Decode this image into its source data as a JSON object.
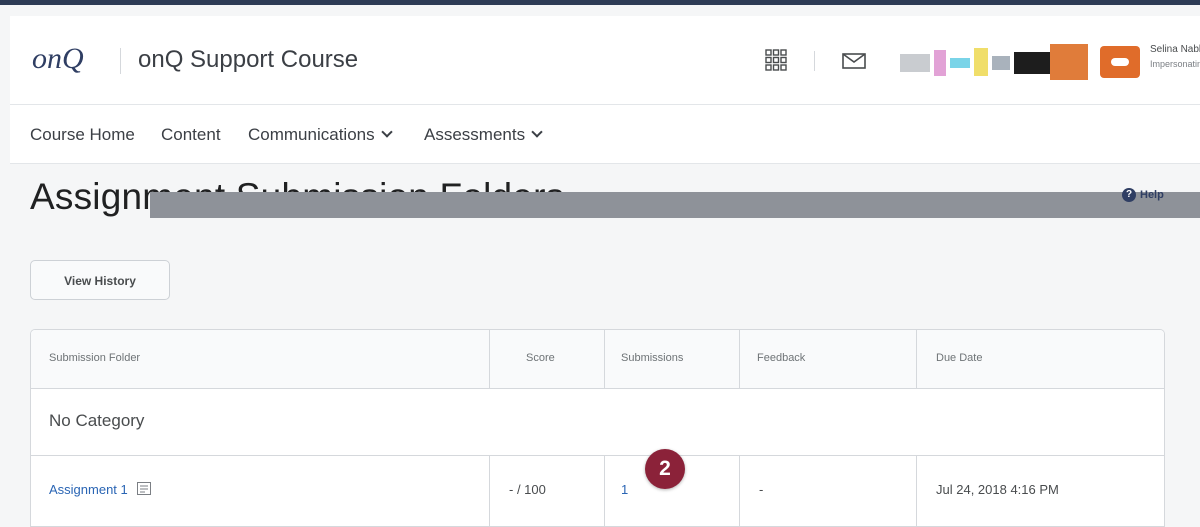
{
  "header": {
    "logo_text": "onQ",
    "course_title": "onQ Support Course",
    "user_name": "Selina Nabbs",
    "user_role": "Impersonating",
    "icons": [
      "apps-grid-icon",
      "message-icon"
    ]
  },
  "nav": {
    "items": [
      {
        "label": "Course Home",
        "dropdown": false
      },
      {
        "label": "Content",
        "dropdown": false
      },
      {
        "label": "Communications",
        "dropdown": true
      },
      {
        "label": "Assessments",
        "dropdown": true
      }
    ]
  },
  "page": {
    "title": "Assignment Submission Folders",
    "help_label": "Help",
    "view_history_label": "View History"
  },
  "table": {
    "columns": [
      "Submission Folder",
      "Score",
      "Submissions",
      "Feedback",
      "Due Date"
    ],
    "category": "No Category",
    "rows": [
      {
        "folder": "Assignment 1",
        "score": "- / 100",
        "submissions": "1",
        "feedback": "-",
        "due_date": "Jul 24, 2018 4:16 PM"
      }
    ]
  },
  "callout": {
    "number": "2"
  },
  "colors": {
    "accent": "#2f3e63",
    "link": "#2a65b4",
    "callout": "#8b2239",
    "avatar": "#e06c2a"
  }
}
